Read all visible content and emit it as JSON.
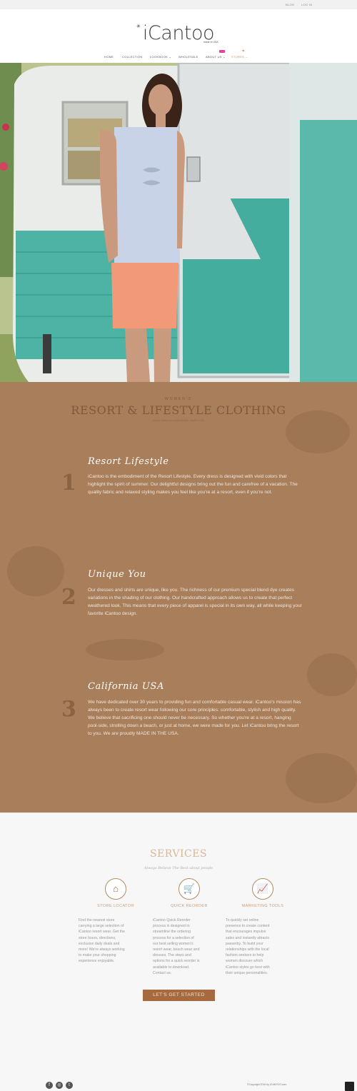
{
  "topbar": {
    "links": [
      "BLOG",
      "LOG IN"
    ]
  },
  "header": {
    "logo_text": "iCantoo",
    "tagline": "made in USA",
    "nav": [
      "HOME",
      "COLLECTION",
      "LOOKBOOK ⌄",
      "WHOLESALE",
      "ABOUT US ⌄",
      "STORES ⌄"
    ]
  },
  "resort": {
    "eyebrow": "WOMEN'S",
    "title": "RESORT & LIFESTYLE CLOTHING",
    "subtitle": "vibrant colors, the resort lifestyle, made in USA",
    "features": [
      {
        "number": "1",
        "title": "Resort Lifestyle",
        "text": "iCantoo is the embodiment of the Resort Lifestyle. Every dress is designed with vivid colors that highlight the spirit of summer. Our delightful designs bring out the fun and carefree of a vacation. The quality fabric and relaxed styling makes you feel like you're at a resort, even if you're not."
      },
      {
        "number": "2",
        "title": "Unique You",
        "text": "Our dresses and shirts are unique, like you. The richness of our premium special blend dye creates variations in the shading of our clothing. Our handcrafted approach allows us to create that perfect weathered look. This means that every piece of apparel is special in its own way, all while keeping your favorite iCantoo design."
      },
      {
        "number": "3",
        "title": "California USA",
        "text": "We have dedicated over 30 years to providing fun and comfortable casual wear. iCantoo's mission has always been to create resort wear following our core principles: comfortable, stylish and high quality. We believe that sacrificing one should never be necessary. So whether you're at a resort, hanging pool-side, strolling down a beach, or just at home, we were made for you. Let iCantoo bring the resort to you. We are proudly MADE IN THE USA."
      }
    ]
  },
  "services": {
    "title": "SERVICES",
    "subtitle": "Always Believe The Best about people",
    "items": [
      {
        "icon": "home-icon",
        "title": "STORE LOCATOR",
        "text": "Find the nearest store carrying a large selection of iCantoo resort wear. Get the store hours, directions, exclusive daily deals and more! We're always working to make your shopping experience enjoyable."
      },
      {
        "icon": "cart-icon",
        "title": "QUICK REORDER",
        "text": "iCantoo Quick Reorder process is designed to streamline the ordering process for a selection of our best selling women's resort wear, beach wear and dresses. The steps and options for a quick reorder is available to download. Contact us."
      },
      {
        "icon": "chart-icon",
        "title": "MARKETING TOOLS",
        "text": "To quickly set online presence to create content that encourages impulse sales and instantly attracts passerby. To build your relationships with the local fashion seekers to help women discover which iCantoo styles go best with their unique personalities."
      }
    ],
    "cta_label": "LET'S GET STARTED"
  },
  "footer": {
    "social_icons": [
      "facebook-icon",
      "instagram-icon",
      "twitter-icon"
    ],
    "copyright": "©Copyright 2016 by ICANTOO.com"
  },
  "colors": {
    "brown_section": "#a87e5b",
    "accent_brown": "#a66a3e",
    "badge_pink": "#e2439c"
  }
}
